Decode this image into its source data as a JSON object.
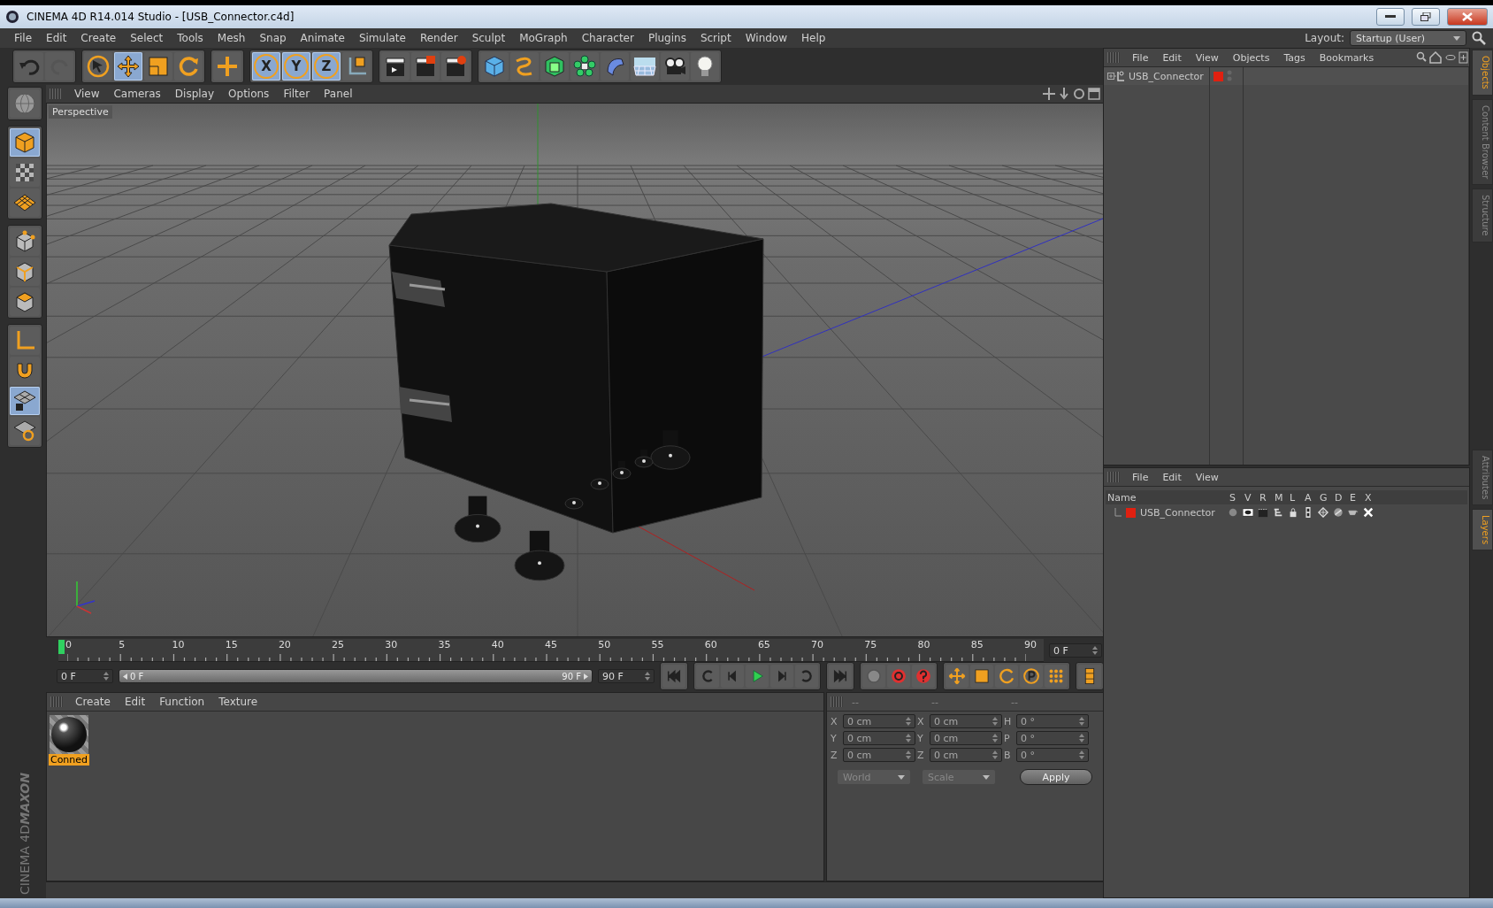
{
  "window": {
    "title": "CINEMA 4D R14.014 Studio - [USB_Connector.c4d]"
  },
  "menu": [
    "File",
    "Edit",
    "Create",
    "Select",
    "Tools",
    "Mesh",
    "Snap",
    "Animate",
    "Simulate",
    "Render",
    "Sculpt",
    "MoGraph",
    "Character",
    "Plugins",
    "Script",
    "Window",
    "Help"
  ],
  "layout": {
    "label": "Layout:",
    "value": "Startup (User)"
  },
  "toolbar": [
    {
      "tools": [
        {
          "kind": "undo",
          "selected": false
        },
        {
          "kind": "redo",
          "selected": false
        }
      ]
    },
    {
      "tools": [
        {
          "kind": "pointer",
          "selected": false
        },
        {
          "kind": "move",
          "selected": true
        },
        {
          "kind": "scale",
          "selected": false
        },
        {
          "kind": "rotate",
          "selected": false
        }
      ]
    },
    {
      "tools": [
        {
          "kind": "plus",
          "selected": false
        }
      ]
    },
    {
      "tools": [
        {
          "kind": "axis",
          "label": "X",
          "selected": true
        },
        {
          "kind": "axis",
          "label": "Y",
          "selected": true
        },
        {
          "kind": "axis",
          "label": "Z",
          "selected": true
        },
        {
          "kind": "coords",
          "selected": false
        }
      ]
    },
    {
      "tools": [
        {
          "kind": "render-view",
          "selected": false
        },
        {
          "kind": "render-picture",
          "selected": false
        },
        {
          "kind": "render-settings",
          "selected": false
        }
      ]
    },
    {
      "tools": [
        {
          "kind": "cube",
          "selected": false
        },
        {
          "kind": "spline",
          "selected": false
        },
        {
          "kind": "nurbs",
          "selected": false
        },
        {
          "kind": "array",
          "selected": false
        },
        {
          "kind": "deformer",
          "selected": false
        },
        {
          "kind": "floor",
          "selected": false
        },
        {
          "kind": "camera",
          "selected": false
        },
        {
          "kind": "light",
          "selected": false
        }
      ]
    }
  ],
  "left_tools": [
    {
      "tools": [
        {
          "kind": "sphere",
          "selected": false
        }
      ]
    },
    {
      "tools": [
        {
          "kind": "model",
          "selected": true
        },
        {
          "kind": "checker",
          "selected": false
        },
        {
          "kind": "workplane",
          "selected": false
        }
      ]
    },
    {
      "tools": [
        {
          "kind": "points",
          "selected": false
        },
        {
          "kind": "edges",
          "selected": false
        },
        {
          "kind": "polygons",
          "selected": false
        }
      ]
    },
    {
      "tools": [
        {
          "kind": "corner",
          "selected": false
        },
        {
          "kind": "magnet",
          "selected": false
        },
        {
          "kind": "gridlock",
          "selected": true
        },
        {
          "kind": "gridturn",
          "selected": false
        }
      ]
    }
  ],
  "viewport": {
    "menu": [
      "View",
      "Cameras",
      "Display",
      "Options",
      "Filter",
      "Panel"
    ],
    "label": "Perspective"
  },
  "timeline": {
    "ticks": [
      "0",
      "5",
      "10",
      "15",
      "20",
      "25",
      "30",
      "35",
      "40",
      "45",
      "50",
      "55",
      "60",
      "65",
      "70",
      "75",
      "80",
      "85",
      "90"
    ],
    "level": 0,
    "current": "0 F",
    "start": "0 F",
    "range": {
      "start": "0 F",
      "end": "90 F"
    },
    "end": "90 F"
  },
  "transport": [
    {
      "tools": [
        {
          "kind": "to-start"
        }
      ]
    },
    {
      "tools": [
        {
          "kind": "prev-key"
        },
        {
          "kind": "prev-frame"
        },
        {
          "kind": "play"
        },
        {
          "kind": "next-frame"
        },
        {
          "kind": "next-key"
        }
      ]
    },
    {
      "tools": [
        {
          "kind": "to-end"
        }
      ]
    },
    {
      "tools": [
        {
          "kind": "keyframe"
        },
        {
          "kind": "record"
        },
        {
          "kind": "help"
        }
      ]
    },
    {
      "tools": [
        {
          "kind": "key-move"
        },
        {
          "kind": "key-scale"
        },
        {
          "kind": "key-rotate"
        },
        {
          "kind": "key-param"
        },
        {
          "kind": "key-grid"
        }
      ]
    },
    {
      "tools": [
        {
          "kind": "film"
        }
      ]
    }
  ],
  "materials": {
    "menu": [
      "Create",
      "Edit",
      "Function",
      "Texture"
    ],
    "items": [
      {
        "name": "Conned",
        "selected": true
      }
    ]
  },
  "coordinates": {
    "headers": [
      "--",
      "--",
      "--"
    ],
    "rows": [
      [
        {
          "label": "X",
          "value": "0 cm"
        },
        {
          "label": "X",
          "value": "0 cm"
        },
        {
          "label": "H",
          "value": "0 °"
        }
      ],
      [
        {
          "label": "Y",
          "value": "0 cm"
        },
        {
          "label": "Y",
          "value": "0 cm"
        },
        {
          "label": "P",
          "value": "0 °"
        }
      ],
      [
        {
          "label": "Z",
          "value": "0 cm"
        },
        {
          "label": "Z",
          "value": "0 cm"
        },
        {
          "label": "B",
          "value": "0 °"
        }
      ]
    ],
    "dropdowns": [
      "World",
      "Scale"
    ],
    "apply": "Apply"
  },
  "objects": {
    "menu": [
      "File",
      "Edit",
      "View",
      "Objects",
      "Tags",
      "Bookmarks"
    ],
    "items": [
      {
        "name": "USB_Connector",
        "color": "#e02010"
      }
    ]
  },
  "layers": {
    "menu": [
      "File",
      "Edit",
      "View"
    ],
    "columns": [
      "Name",
      "S",
      "V",
      "R",
      "M",
      "L",
      "A",
      "G",
      "D",
      "E",
      "X"
    ],
    "rows": [
      {
        "name": "USB_Connector",
        "color": "#e02010"
      }
    ]
  },
  "side_tabs": [
    {
      "label": "Objects",
      "selected": true
    },
    {
      "label": "Content Browser",
      "selected": false
    },
    {
      "label": "Structure",
      "selected": false
    },
    {
      "label": "Attributes",
      "selected": false
    },
    {
      "label": "Layers",
      "selected": true
    }
  ],
  "logo": {
    "brand": "MAXON",
    "product": "CINEMA 4D"
  }
}
